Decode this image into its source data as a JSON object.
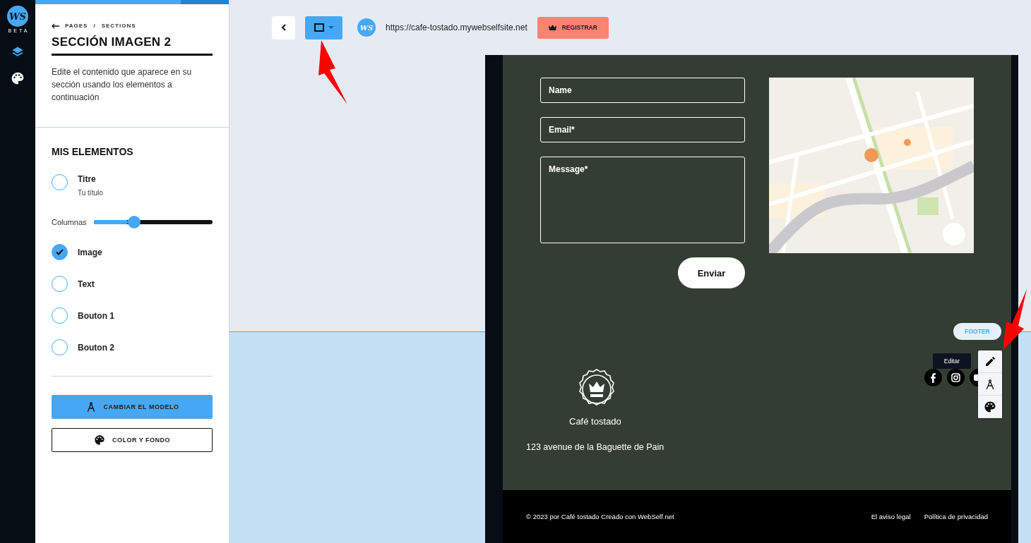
{
  "rail": {
    "logo_text": "WS",
    "beta": "BETA"
  },
  "progress": {
    "level": 0.75
  },
  "breadcrumb": {
    "items": [
      "PAGES",
      "SECTIONS"
    ],
    "separator": "/"
  },
  "panel": {
    "title": "SECCIÓN IMAGEN 2",
    "description": "Edite el contenido que aparece en su sección usando los elementos a continuación"
  },
  "elements_heading": "MIS ELEMENTOS",
  "elements": [
    {
      "kind": "checkbox",
      "label": "Titre",
      "sublabel": "Tu título",
      "checked": false
    },
    {
      "kind": "slider",
      "label": "Columnas",
      "level": 0.34
    },
    {
      "kind": "checkbox",
      "label": "Image",
      "checked": true
    },
    {
      "kind": "checkbox",
      "label": "Text",
      "checked": false
    },
    {
      "kind": "checkbox",
      "label": "Bouton 1",
      "checked": false
    },
    {
      "kind": "checkbox",
      "label": "Bouton 2",
      "checked": false
    }
  ],
  "actions": [
    {
      "kind": "primary",
      "label": "CAMBIAR EL MODELO"
    },
    {
      "kind": "outline",
      "label": "COLOR Y FONDO"
    }
  ],
  "toolbar": {
    "site_logo_text": "WS",
    "url": "https://cafe-tostado.mywebselfsite.net",
    "register": "REGISTRAR"
  },
  "form": {
    "fields": [
      {
        "kind": "input",
        "placeholder": "Name"
      },
      {
        "kind": "input",
        "placeholder": "Email*"
      },
      {
        "kind": "textarea",
        "placeholder": "Message*"
      }
    ],
    "submit": "Enviar"
  },
  "footer": {
    "section_label": "FOOTER",
    "tooltip": "Editar",
    "brand": "Café tostado",
    "address": "123 avenue de la Baguette de Pain",
    "copyright": "© 2023 por Café tostado Creado con WebSelf.net",
    "links": [
      "El aviso legal",
      "Política de privacidad"
    ]
  }
}
